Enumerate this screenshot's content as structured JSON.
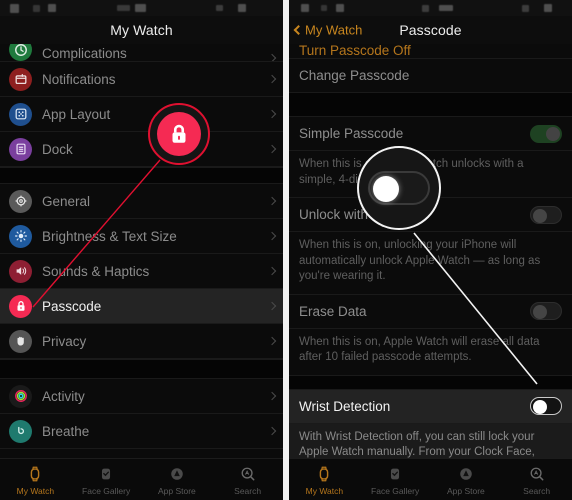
{
  "left_panel": {
    "nav": {
      "title": "My Watch"
    },
    "items": [
      {
        "label": "Complications",
        "icon": "complications-icon",
        "icon_color": "#1f7a3d",
        "cut": true,
        "selected": false
      },
      {
        "label": "Notifications",
        "icon": "notifications-icon",
        "icon_color": "#8e1f1f",
        "selected": false
      },
      {
        "label": "App Layout",
        "icon": "app-layout-icon",
        "icon_color": "#1f4f8e",
        "selected": false
      },
      {
        "label": "Dock",
        "icon": "dock-icon",
        "icon_color": "#7a3f9e",
        "selected": false
      },
      {
        "label": "General",
        "icon": "gear-icon",
        "icon_color": "#5a5a5a",
        "selected": false
      },
      {
        "label": "Brightness & Text Size",
        "icon": "brightness-icon",
        "icon_color": "#1f5a9e",
        "selected": false
      },
      {
        "label": "Sounds & Haptics",
        "icon": "sounds-icon",
        "icon_color": "#8e1f33",
        "selected": false
      },
      {
        "label": "Passcode",
        "icon": "lock-icon",
        "icon_color": "#f52a53",
        "selected": true
      },
      {
        "label": "Privacy",
        "icon": "privacy-hand-icon",
        "icon_color": "#555555",
        "selected": false
      },
      {
        "label": "Activity",
        "icon": "activity-rings-icon",
        "icon_color": "#2a2a2a",
        "selected": false
      },
      {
        "label": "Breathe",
        "icon": "breathe-icon",
        "icon_color": "#1f7a6e",
        "selected": false
      }
    ]
  },
  "right_panel": {
    "nav": {
      "back_label": "My Watch",
      "title": "Passcode"
    },
    "rows": [
      {
        "label": "Turn Passcode Off",
        "type": "action-orange"
      },
      {
        "label": "Change Passcode",
        "type": "action"
      },
      {
        "label": "Simple Passcode",
        "type": "toggle",
        "state": "on"
      },
      {
        "label": "When this is on, Apple Watch unlocks with a simple, 4-digit passcode.",
        "type": "footnote"
      },
      {
        "label": "Unlock with iPhone",
        "type": "toggle",
        "state": "off"
      },
      {
        "label": "When this is on, unlocking your iPhone will automatically unlock Apple Watch — as long as you're wearing it.",
        "type": "footnote"
      },
      {
        "label": "Erase Data",
        "type": "toggle",
        "state": "off"
      },
      {
        "label": "When this is on, Apple Watch will erase all data after 10 failed passcode attempts.",
        "type": "footnote"
      },
      {
        "label": "Wrist Detection",
        "type": "toggle",
        "state": "off",
        "highlighted": true
      },
      {
        "label": "With Wrist Detection off, you can still lock your Apple Watch manually. From your Clock Face, swipe up to Control Center and turn passcode lock on.",
        "type": "footnote"
      }
    ]
  },
  "tabbar": {
    "tabs": [
      {
        "label": "My Watch",
        "icon": "watch-icon",
        "active": true
      },
      {
        "label": "Face Gallery",
        "icon": "face-gallery-icon",
        "active": false
      },
      {
        "label": "App Store",
        "icon": "app-store-icon",
        "active": false
      },
      {
        "label": "Search",
        "icon": "search-icon",
        "active": false
      }
    ]
  },
  "callouts": {
    "left": {
      "name": "passcode-lock-magnifier",
      "icon": "lock-icon",
      "ring_color": "#e01030",
      "fill_color": "#f52a53"
    },
    "right": {
      "name": "wrist-detection-toggle-magnifier",
      "state": "off",
      "ring_color": "#f3f3f3"
    }
  },
  "colors": {
    "accent_orange": "#b5761c",
    "accent_red": "#f52a53",
    "toggle_on_green": "#1e4222",
    "background": "#0b0b0b"
  }
}
